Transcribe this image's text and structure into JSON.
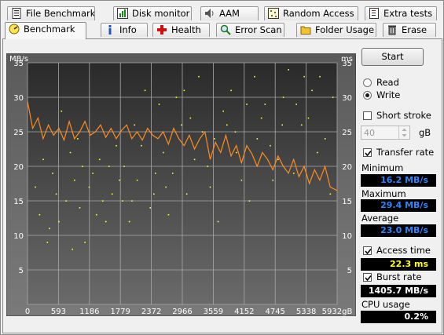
{
  "tabs_row1": [
    {
      "label": "File Benchmark",
      "icon": "file-benchmark-icon"
    },
    {
      "label": "Disk monitor",
      "icon": "disk-monitor-icon"
    },
    {
      "label": "AAM",
      "icon": "speaker-icon"
    },
    {
      "label": "Random Access",
      "icon": "random-access-icon"
    },
    {
      "label": "Extra tests",
      "icon": "extra-tests-icon"
    }
  ],
  "tabs_row2": [
    {
      "label": "Benchmark",
      "icon": "benchmark-icon",
      "active": true
    },
    {
      "label": "Info",
      "icon": "info-icon"
    },
    {
      "label": "Health",
      "icon": "health-cross-icon"
    },
    {
      "label": "Error Scan",
      "icon": "magnifier-icon"
    },
    {
      "label": "Folder Usage",
      "icon": "folder-icon"
    },
    {
      "label": "Erase",
      "icon": "trash-icon"
    }
  ],
  "controls": {
    "start_label": "Start",
    "read_label": "Read",
    "write_label": "Write",
    "mode_selected": "Write",
    "short_stroke_label": "Short stroke",
    "short_stroke_checked": false,
    "stroke_value": "40",
    "stroke_unit": "gB",
    "transfer_rate_label": "Transfer rate",
    "transfer_rate_checked": true,
    "access_time_label": "Access time",
    "access_time_checked": true,
    "burst_rate_label": "Burst rate",
    "burst_rate_checked": true
  },
  "stats": {
    "minimum_label": "Minimum",
    "minimum_value": "16.2 MB/s",
    "maximum_label": "Maximum",
    "maximum_value": "29.4 MB/s",
    "average_label": "Average",
    "average_value": "23.0 MB/s",
    "access_time_value": "22.3 ms",
    "burst_rate_value": "1405.7 MB/s",
    "cpu_usage_label": "CPU usage",
    "cpu_usage_value": "0.2%"
  },
  "colors": {
    "line": "#ff8c1a",
    "dots": "#ffff33",
    "min_max_avg_value": "#2d86ff",
    "access_value": "#ffff2a"
  },
  "chart_data": {
    "type": "line",
    "y_left_unit": "MB/s",
    "y_right_unit": "ms",
    "ylim": [
      0,
      35
    ],
    "xlim": [
      0,
      5932
    ],
    "x_ticks": [
      "0",
      "593",
      "1186",
      "1779",
      "2372",
      "2966",
      "3559",
      "4152",
      "4745",
      "5338",
      "5932gB"
    ],
    "y_ticks": [
      "5",
      "10",
      "15",
      "20",
      "25",
      "30",
      "35"
    ],
    "grid": true,
    "series": [
      {
        "name": "Transfer rate",
        "x": [
          0,
          100,
          200,
          300,
          400,
          500,
          600,
          700,
          800,
          900,
          1000,
          1100,
          1200,
          1300,
          1400,
          1500,
          1600,
          1700,
          1800,
          1900,
          2000,
          2100,
          2200,
          2300,
          2400,
          2500,
          2600,
          2700,
          2800,
          2900,
          3000,
          3100,
          3200,
          3300,
          3400,
          3500,
          3600,
          3700,
          3800,
          3900,
          4000,
          4100,
          4200,
          4300,
          4400,
          4500,
          4600,
          4700,
          4800,
          4900,
          5000,
          5100,
          5200,
          5300,
          5400,
          5500,
          5600,
          5700,
          5800,
          5932
        ],
        "y": [
          29.4,
          25.5,
          27,
          24,
          26,
          24.5,
          25.5,
          23.8,
          26.5,
          24,
          25,
          26.5,
          24.5,
          25,
          26,
          24.2,
          25.5,
          24,
          25.2,
          26,
          24,
          25,
          23.8,
          25.5,
          24.5,
          24,
          25,
          23.2,
          25.5,
          24,
          23,
          24.5,
          22.5,
          24,
          25,
          21,
          23.5,
          22,
          24.5,
          21.5,
          23,
          20.5,
          23,
          21.8,
          20,
          22,
          21,
          19.5,
          21.5,
          20,
          19,
          21,
          18.5,
          20,
          17.5,
          19.5,
          18,
          20,
          17,
          16.5
        ]
      }
    ],
    "access_points": [
      {
        "x": 300,
        "y": 21
      },
      {
        "x": 550,
        "y": 16
      },
      {
        "x": 820,
        "y": 22
      },
      {
        "x": 1000,
        "y": 14
      },
      {
        "x": 1250,
        "y": 19
      },
      {
        "x": 1500,
        "y": 12
      },
      {
        "x": 1700,
        "y": 23
      },
      {
        "x": 2000,
        "y": 15
      },
      {
        "x": 2250,
        "y": 31
      },
      {
        "x": 2450,
        "y": 19
      },
      {
        "x": 2700,
        "y": 13
      },
      {
        "x": 2950,
        "y": 26
      },
      {
        "x": 3200,
        "y": 21
      },
      {
        "x": 3500,
        "y": 17
      },
      {
        "x": 3750,
        "y": 28
      },
      {
        "x": 4000,
        "y": 22
      },
      {
        "x": 4200,
        "y": 29
      },
      {
        "x": 4400,
        "y": 24
      },
      {
        "x": 4650,
        "y": 23
      },
      {
        "x": 4900,
        "y": 30
      },
      {
        "x": 5100,
        "y": 19
      },
      {
        "x": 5300,
        "y": 33
      },
      {
        "x": 5550,
        "y": 22
      },
      {
        "x": 5800,
        "y": 16
      },
      {
        "x": 150,
        "y": 17
      },
      {
        "x": 420,
        "y": 11
      },
      {
        "x": 650,
        "y": 28
      },
      {
        "x": 900,
        "y": 18
      },
      {
        "x": 1100,
        "y": 9
      },
      {
        "x": 1380,
        "y": 21
      },
      {
        "x": 1620,
        "y": 16
      },
      {
        "x": 1850,
        "y": 20
      },
      {
        "x": 2100,
        "y": 18
      },
      {
        "x": 2350,
        "y": 14
      },
      {
        "x": 2600,
        "y": 22
      },
      {
        "x": 2850,
        "y": 30
      },
      {
        "x": 3050,
        "y": 16
      },
      {
        "x": 3350,
        "y": 25
      },
      {
        "x": 3650,
        "y": 12
      },
      {
        "x": 3900,
        "y": 31
      },
      {
        "x": 4100,
        "y": 18
      },
      {
        "x": 4350,
        "y": 33
      },
      {
        "x": 4550,
        "y": 29
      },
      {
        "x": 4800,
        "y": 21
      },
      {
        "x": 5000,
        "y": 34
      },
      {
        "x": 5250,
        "y": 26
      },
      {
        "x": 5450,
        "y": 31
      },
      {
        "x": 5700,
        "y": 24
      },
      {
        "x": 230,
        "y": 13
      },
      {
        "x": 480,
        "y": 19
      },
      {
        "x": 740,
        "y": 15
      },
      {
        "x": 960,
        "y": 24
      },
      {
        "x": 1180,
        "y": 17
      },
      {
        "x": 1440,
        "y": 15
      },
      {
        "x": 1760,
        "y": 18
      },
      {
        "x": 1950,
        "y": 12
      },
      {
        "x": 2180,
        "y": 23
      },
      {
        "x": 2420,
        "y": 16
      },
      {
        "x": 2780,
        "y": 19
      },
      {
        "x": 3120,
        "y": 27
      },
      {
        "x": 3450,
        "y": 20
      },
      {
        "x": 3820,
        "y": 26
      },
      {
        "x": 4250,
        "y": 15
      },
      {
        "x": 4700,
        "y": 18
      },
      {
        "x": 5150,
        "y": 29
      },
      {
        "x": 5600,
        "y": 33
      },
      {
        "x": 380,
        "y": 9
      },
      {
        "x": 600,
        "y": 12
      },
      {
        "x": 860,
        "y": 8
      },
      {
        "x": 1050,
        "y": 20
      },
      {
        "x": 1320,
        "y": 13
      },
      {
        "x": 1560,
        "y": 20
      },
      {
        "x": 1820,
        "y": 15
      },
      {
        "x": 2050,
        "y": 26
      },
      {
        "x": 2520,
        "y": 29
      },
      {
        "x": 2650,
        "y": 17
      },
      {
        "x": 3000,
        "y": 31
      },
      {
        "x": 3280,
        "y": 33
      },
      {
        "x": 3580,
        "y": 24
      },
      {
        "x": 3980,
        "y": 25
      },
      {
        "x": 4480,
        "y": 27
      },
      {
        "x": 4880,
        "y": 26
      },
      {
        "x": 5380,
        "y": 27
      },
      {
        "x": 5850,
        "y": 30
      }
    ]
  }
}
